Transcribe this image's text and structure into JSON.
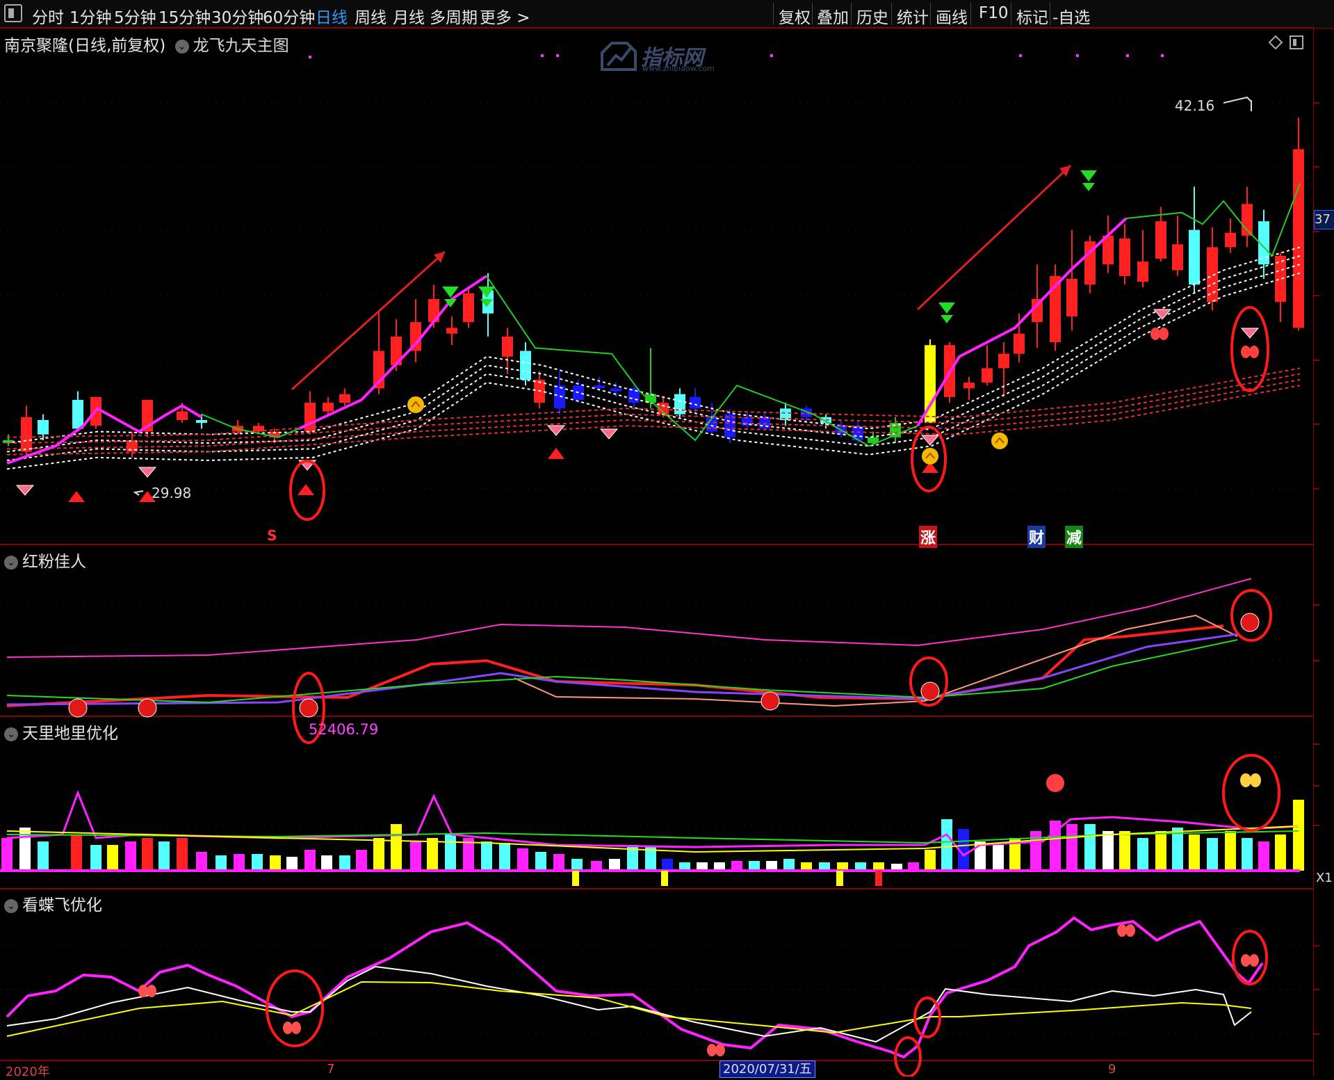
{
  "toolbar": {
    "left_items": [
      "分时",
      "1分钟",
      "5分钟",
      "15分钟",
      "30分钟",
      "60分钟",
      "日线",
      "周线",
      "月线",
      "多周期",
      "更多 >"
    ],
    "active_index": 6,
    "right_items": [
      "复权",
      "叠加",
      "历史",
      "统计",
      "画线",
      "F10",
      "标记",
      "-自选"
    ]
  },
  "main_chart": {
    "stock_title": "南京聚隆(日线,前复权)",
    "indicator_name": "龙飞九天主图",
    "high_label": "42.16",
    "low_label": "29.98",
    "right_value": "37",
    "markers": {
      "s": "S",
      "zhang": "涨",
      "cai": "财",
      "jian": "减"
    }
  },
  "watermark": {
    "text": "指标网",
    "sub": "www.zhibiaow.com"
  },
  "panel2": {
    "title": "红粉佳人"
  },
  "panel3": {
    "title": "天里地里优化",
    "value": "52406.79",
    "axis_tag": "X1"
  },
  "panel4": {
    "title": "看蝶飞优化"
  },
  "bottom_axis": {
    "year": "2020年",
    "m7": "7",
    "date": "2020/07/31/五",
    "m9": "9"
  },
  "colors": {
    "up": "#ff2020",
    "down_cyan": "#55ffff",
    "down_blue": "#1a1aff",
    "magenta": "#ff22ff",
    "green": "#22cc22",
    "yellow": "#ffff00",
    "circle": "#ff1a1a"
  }
}
